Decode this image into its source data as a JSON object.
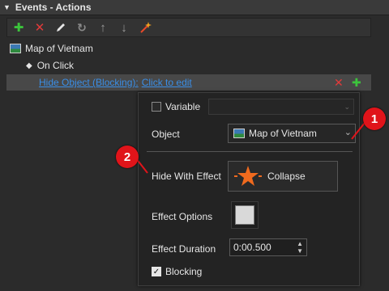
{
  "panel": {
    "title": "Events - Actions"
  },
  "toolbar": {
    "icons": [
      "add-icon",
      "delete-icon",
      "edit-icon",
      "undo-icon",
      "move-up-icon",
      "move-down-icon",
      "magic-icon"
    ]
  },
  "tree": {
    "object_name": "Map of Vietnam",
    "event_name": "On Click",
    "action_label": "Hide Object (Blocking):",
    "action_hint": "Click to edit"
  },
  "popup": {
    "variable_label": "Variable",
    "variable_value": "",
    "object_label": "Object",
    "object_value": "Map of Vietnam",
    "hide_effect_label": "Hide With Effect",
    "effect_name": "Collapse",
    "effect_options_label": "Effect Options",
    "effect_duration_label": "Effect Duration",
    "effect_duration_value": "0:00.500",
    "blocking_label": "Blocking"
  },
  "callouts": {
    "one": "1",
    "two": "2"
  },
  "colors": {
    "accent_link": "#3a8ee6",
    "callout": "#e0141a",
    "effect_star": "#f06a1e"
  }
}
